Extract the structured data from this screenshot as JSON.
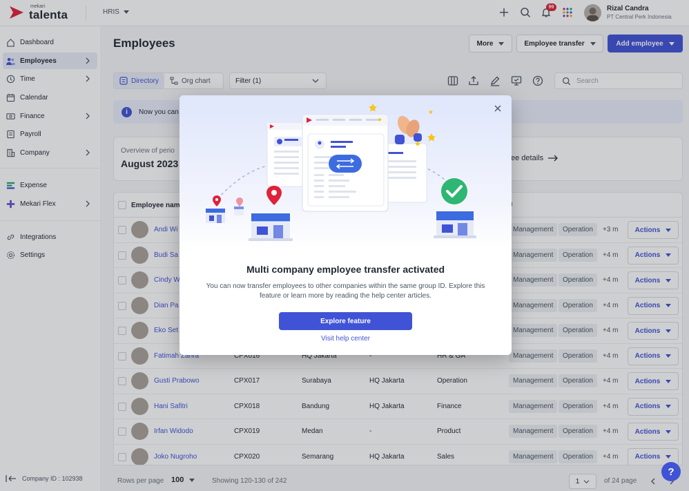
{
  "app": {
    "brand_small": "mekari",
    "brand_big": "talenta",
    "product": "HRIS",
    "notifications_count": "99",
    "user_name": "Rizal Candra",
    "user_company": "PT Central Perk Indonesia",
    "accent_color": "#4053d6",
    "brand_color": "#e0223a"
  },
  "sidebar": {
    "items": [
      {
        "label": "Dashboard",
        "icon": "home-icon"
      },
      {
        "label": "Employees",
        "icon": "users-icon",
        "active": true
      },
      {
        "label": "Time",
        "icon": "clock-icon"
      },
      {
        "label": "Calendar",
        "icon": "calendar-icon"
      },
      {
        "label": "Finance",
        "icon": "money-icon"
      },
      {
        "label": "Payroll",
        "icon": "payroll-icon"
      },
      {
        "label": "Company",
        "icon": "building-icon"
      },
      {
        "label": "Expense",
        "icon": "expense-icon"
      },
      {
        "label": "Mekari Flex",
        "icon": "plus-icon"
      },
      {
        "label": "Integrations",
        "icon": "link-icon"
      },
      {
        "label": "Settings",
        "icon": "gear-icon"
      }
    ],
    "company_id": "Company ID : 102938"
  },
  "header": {
    "title": "Employees",
    "more_label": "More",
    "transfer_label": "Employee transfer",
    "add_label": "Add employee"
  },
  "toolbar": {
    "directory_label": "Directory",
    "org_chart_label": "Org chart",
    "filter_label": "Filter (1)",
    "search_placeholder": "Search"
  },
  "banner": {
    "text": "Now you can"
  },
  "overview": {
    "label": "Overview of perio",
    "period": "August 2023",
    "link": "ee details"
  },
  "table": {
    "headers": {
      "name": "Employee name",
      "bu": "U"
    },
    "rows": [
      {
        "name": "Andi Wi",
        "id": "",
        "city": "",
        "branch": "",
        "dept": "",
        "more": "+3 m"
      },
      {
        "name": "Budi Sa",
        "id": "",
        "city": "",
        "branch": "",
        "dept": "",
        "more": "+4 m"
      },
      {
        "name": "Cindy W",
        "id": "",
        "city": "",
        "branch": "",
        "dept": "",
        "more": "+4 m"
      },
      {
        "name": "Dian Pa",
        "id": "",
        "city": "",
        "branch": "",
        "dept": "",
        "more": "+4 m"
      },
      {
        "name": "Eko Set",
        "id": "",
        "city": "",
        "branch": "",
        "dept": "",
        "more": "+4 m"
      },
      {
        "name": "Fatimah Zahra",
        "id": "CPX016",
        "city": "HQ Jakarta",
        "branch": "-",
        "dept": "HR & GA",
        "more": "+4 m"
      },
      {
        "name": "Gusti Prabowo",
        "id": "CPX017",
        "city": "Surabaya",
        "branch": "HQ Jakarta",
        "dept": "Operation",
        "more": "+4 m"
      },
      {
        "name": "Hani Safitri",
        "id": "CPX018",
        "city": "Bandung",
        "branch": "HQ Jakarta",
        "dept": "Finance",
        "more": "+4 m"
      },
      {
        "name": "Irfan Widodo",
        "id": "CPX019",
        "city": "Medan",
        "branch": "-",
        "dept": "Product",
        "more": "+4 m"
      },
      {
        "name": "Joko Nugroho",
        "id": "CPX020",
        "city": "Semarang",
        "branch": "HQ Jakarta",
        "dept": "Sales",
        "more": "+4 m"
      }
    ],
    "chip1": "Management",
    "chip2": "Operation",
    "actions_label": "Actions"
  },
  "footer": {
    "rows_label": "Rows per page",
    "rows_value": "100",
    "showing": "Showing 120-130 of 242",
    "page_value": "1",
    "of_pages": "of 24 page"
  },
  "modal": {
    "title": "Multi company employee transfer activated",
    "description": "You can now transfer employees to other companies within the same group ID. Explore this feature or learn more by reading the help center articles.",
    "primary_label": "Explore feature",
    "link_label": "Visit help center"
  },
  "help_fab": "?"
}
